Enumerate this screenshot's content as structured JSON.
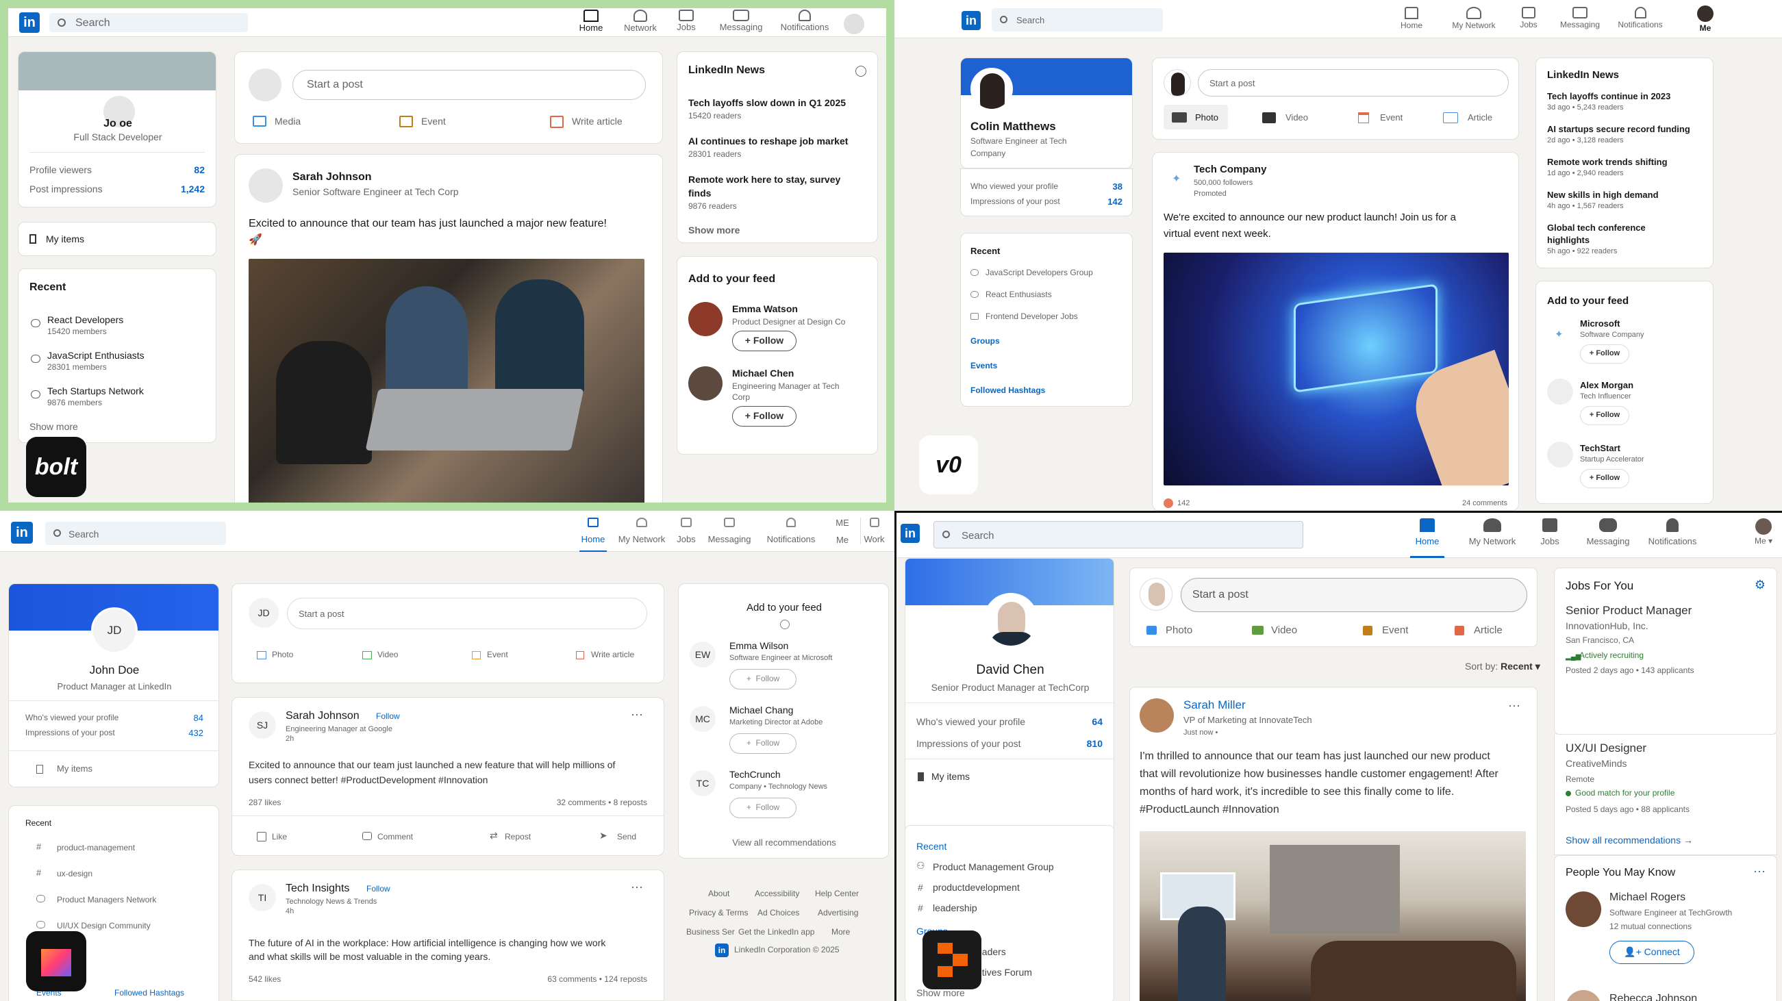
{
  "q1": {
    "search": "Search",
    "nav": [
      "Home",
      "Network",
      "Jobs",
      "Messaging",
      "Notifications"
    ],
    "profile": {
      "name": "John Doe",
      "name_visible": "Jo     oe",
      "title": "Full Stack Developer",
      "viewers_label": "Profile viewers",
      "viewers": "82",
      "impr_label": "Post impressions",
      "impr": "1,242"
    },
    "my_items": "My items",
    "recent": {
      "title": "Recent",
      "items": [
        {
          "name": "React Developers",
          "meta": "15420 members"
        },
        {
          "name": "JavaScript Enthusiasts",
          "meta": "28301 members"
        },
        {
          "name": "Tech Startups Network",
          "meta": "9876 members"
        }
      ],
      "more": "Show more"
    },
    "composer": {
      "placeholder": "Start a post",
      "actions": [
        "Media",
        "Event",
        "Write article"
      ]
    },
    "post": {
      "author": "Sarah Johnson",
      "role": "Senior Software Engineer at Tech Corp",
      "text": "Excited to announce that our team has just launched a major new feature!",
      "emoji": "🚀"
    },
    "news": {
      "title": "LinkedIn News",
      "items": [
        {
          "h": "Tech layoffs slow down in Q1 2025",
          "m": "15420 readers"
        },
        {
          "h": "AI continues to reshape job market",
          "m": "28301 readers"
        },
        {
          "h": "Remote work here to stay, survey",
          "h2": "finds",
          "m": "9876 readers"
        }
      ],
      "more": "Show more"
    },
    "feed": {
      "title": "Add to your feed",
      "people": [
        {
          "name": "Emma Watson",
          "role": "Product Designer at Design Co",
          "btn": "+ Follow"
        },
        {
          "name": "Michael Chen",
          "role": "Engineering Manager at Tech",
          "role2": "Corp",
          "btn": "+ Follow"
        }
      ]
    },
    "badge": "bolt"
  },
  "q2": {
    "search": "Search",
    "nav": [
      "Home",
      "My Network",
      "Jobs",
      "Messaging",
      "Notifications",
      "Me"
    ],
    "profile": {
      "name": "Colin Matthews",
      "title": "Software Engineer at Tech",
      "title2": "Company",
      "viewers_label": "Who viewed your profile",
      "viewers": "38",
      "impr_label": "Impressions of your post",
      "impr": "142"
    },
    "recent": {
      "title": "Recent",
      "items": [
        "JavaScript Developers Group",
        "React Enthusiasts",
        "Frontend Developer Jobs"
      ],
      "links": [
        "Groups",
        "Events",
        "Followed Hashtags"
      ]
    },
    "composer": {
      "placeholder": "Start a post",
      "actions": [
        "Photo",
        "Video",
        "Event",
        "Article"
      ]
    },
    "post": {
      "author": "Tech Company",
      "followers": "500,000 followers",
      "promoted": "Promoted",
      "text": "We're excited to announce our new product launch! Join us for a",
      "text2": "virtual event next week.",
      "likes": "142",
      "comments": "24 comments"
    },
    "news": {
      "title": "LinkedIn News",
      "items": [
        {
          "h": "Tech layoffs continue in 2023",
          "m": "3d ago • 5,243 readers"
        },
        {
          "h": "AI startups secure record funding",
          "m": "2d ago • 3,128 readers"
        },
        {
          "h": "Remote work trends shifting",
          "m": "1d ago • 2,940 readers"
        },
        {
          "h": "New skills in high demand",
          "m": "4h ago • 1,567 readers"
        },
        {
          "h": "Global tech conference",
          "h2": "highlights",
          "m": "5h ago • 922 readers"
        }
      ]
    },
    "feed": {
      "title": "Add to your feed",
      "people": [
        {
          "name": "Microsoft",
          "role": "Software Company",
          "btn": "+ Follow"
        },
        {
          "name": "Alex Morgan",
          "role": "Tech Influencer",
          "btn": "+ Follow"
        },
        {
          "name": "TechStart",
          "role": "Startup Accelerator",
          "btn": "+ Follow"
        }
      ]
    },
    "badge": "v0"
  },
  "q3": {
    "search": "Search",
    "nav": [
      "Home",
      "My Network",
      "Jobs",
      "Messaging",
      "Notifications",
      "Me",
      "Work"
    ],
    "me_initials": "ME",
    "profile": {
      "initials": "JD",
      "name": "John Doe",
      "title": "Product Manager at LinkedIn",
      "viewers_label": "Who's viewed your profile",
      "viewers": "84",
      "impr_label": "Impressions of your post",
      "impr": "432"
    },
    "my_items": "My items",
    "recent": {
      "title": "Recent",
      "items": [
        "product-management",
        "ux-design",
        "Product Managers Network",
        "UI/UX Design Community"
      ],
      "links": [
        "Events",
        "Followed Hashtags"
      ]
    },
    "composer": {
      "initials": "JD",
      "placeholder": "Start a post",
      "actions": [
        "Photo",
        "Video",
        "Event",
        "Write article"
      ]
    },
    "post": {
      "initials": "SJ",
      "author": "Sarah Johnson",
      "follow": "Follow",
      "role": "Engineering Manager at Google",
      "time": "2h",
      "text": "Excited to announce that our team just launched a new feature that will help millions of",
      "text2": "users connect better! #ProductDevelopment #Innovation",
      "likes": "287 likes",
      "stats": "32 comments • 8 reposts",
      "actions": [
        "Like",
        "Comment",
        "Repost",
        "Send"
      ]
    },
    "post2": {
      "initials": "TI",
      "author": "Tech Insights",
      "follow": "Follow",
      "role": "Technology News & Trends",
      "time": "4h",
      "text": "The future of AI in the workplace: How artificial intelligence is changing how we work",
      "text2": "and what skills will be most valuable in the coming years.",
      "likes": "542 likes",
      "stats": "63 comments • 124 reposts"
    },
    "feed": {
      "title": "Add to your feed",
      "people": [
        {
          "initials": "EW",
          "name": "Emma Wilson",
          "role": "Software Engineer at Microsoft",
          "btn": "Follow"
        },
        {
          "initials": "MC",
          "name": "Michael Chang",
          "role": "Marketing Director at Adobe",
          "btn": "Follow"
        },
        {
          "initials": "TC",
          "name": "TechCrunch",
          "role": "Company • Technology News",
          "btn": "Follow"
        }
      ],
      "more": "View all recommendations"
    },
    "footer": {
      "row1": [
        "About",
        "Accessibility",
        "Help Center"
      ],
      "row2": [
        "Privacy & Terms",
        "Ad Choices",
        "Advertising"
      ],
      "row3": [
        "Business Ser",
        "Get the LinkedIn app",
        "More"
      ],
      "copy": "LinkedIn Corporation © 2025"
    }
  },
  "q4": {
    "search": "Search",
    "nav": [
      "Home",
      "My Network",
      "Jobs",
      "Messaging",
      "Notifications",
      "Me ▾"
    ],
    "profile": {
      "name": "David Chen",
      "title": "Senior Product Manager at TechCorp",
      "viewers_label": "Who's viewed your profile",
      "viewers": "64",
      "impr_label": "Impressions of your post",
      "impr": "810"
    },
    "my_items": "My items",
    "recent": {
      "title": "Recent",
      "items": [
        "Product Management Group",
        "productdevelopment",
        "leadership"
      ],
      "groups": "Groups",
      "group_items": [
        "eaders",
        "utives Forum"
      ],
      "more": "Show more"
    },
    "composer": {
      "placeholder": "Start a post",
      "actions": [
        "Photo",
        "Video",
        "Event",
        "Article"
      ]
    },
    "sort": {
      "label": "Sort by:",
      "value": "Recent ▾"
    },
    "post": {
      "author": "Sarah Miller",
      "role": "VP of Marketing at InnovateTech",
      "time": "Just now •",
      "text": [
        "I'm thrilled to announce that our team has just launched our new product",
        "that will revolutionize how businesses handle customer engagement! After",
        "months of hard work, it's incredible to see this finally come to life.",
        "#ProductLaunch #Innovation"
      ]
    },
    "jobs": {
      "title": "Jobs For You",
      "items": [
        {
          "t": "Senior Product Manager",
          "c": "InnovationHub, Inc.",
          "l": "San Francisco, CA",
          "s": "Actively recruiting",
          "p": "Posted 2 days ago • 143 applicants"
        },
        {
          "t": "UX/UI Designer",
          "c": "CreativeMinds",
          "l": "Remote",
          "s": "Good match for your profile",
          "p": "Posted 5 days ago • 88 applicants"
        }
      ],
      "more": "Show all recommendations →"
    },
    "people": {
      "title": "People You May Know",
      "name": "Michael Rogers",
      "role": "Software Engineer at TechGrowth",
      "mutual": "12 mutual connections",
      "btn": "Connect",
      "next": "Rebecca Johnson"
    }
  }
}
